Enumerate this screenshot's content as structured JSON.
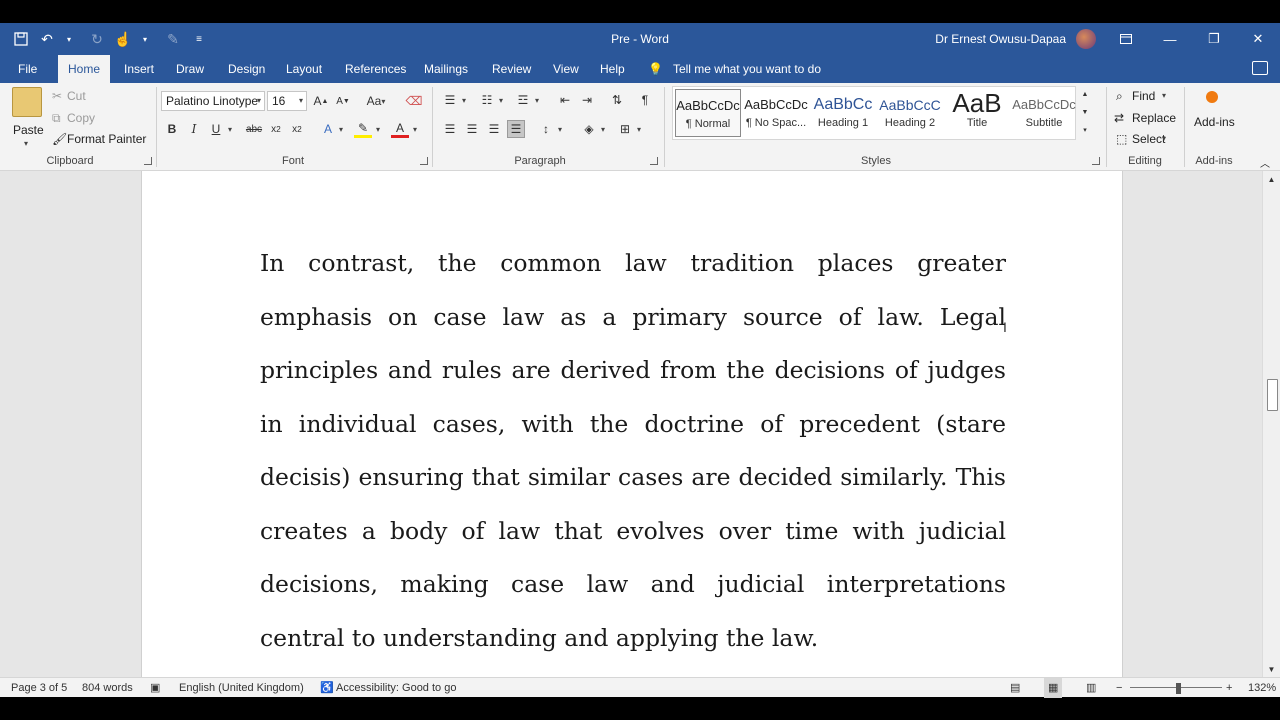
{
  "titlebar": {
    "doc_title": "Pre  -  Word",
    "user_name": "Dr Ernest Owusu-Dapaa",
    "qat_icons": [
      "save-icon",
      "undo-icon",
      "redo-icon",
      "touch-mode-icon",
      "pen-icon",
      "customize-icon"
    ]
  },
  "tabs": {
    "items": [
      "File",
      "Home",
      "Insert",
      "Draw",
      "Design",
      "Layout",
      "References",
      "Mailings",
      "Review",
      "View",
      "Help"
    ],
    "active": "Home",
    "tell_me": "Tell me what you want to do"
  },
  "ribbon": {
    "clipboard": {
      "paste": "Paste",
      "cut": "Cut",
      "copy": "Copy",
      "format_painter": "Format Painter",
      "label": "Clipboard"
    },
    "font": {
      "family": "Palatino Linotype",
      "size": "16",
      "change_case": "Aa",
      "label": "Font"
    },
    "paragraph": {
      "label": "Paragraph"
    },
    "styles": {
      "label": "Styles",
      "items": [
        {
          "sample": "AaBbCcDc",
          "name": "¶ Normal"
        },
        {
          "sample": "AaBbCcDc",
          "name": "¶ No Spac..."
        },
        {
          "sample": "AaBbCc",
          "name": "Heading 1"
        },
        {
          "sample": "AaBbCcC",
          "name": "Heading 2"
        },
        {
          "sample": "AaB",
          "name": "Title"
        },
        {
          "sample": "AaBbCcDc",
          "name": "Subtitle"
        }
      ],
      "selected": "¶ Normal"
    },
    "editing": {
      "find": "Find",
      "replace": "Replace",
      "select": "Select",
      "label": "Editing"
    },
    "addins": {
      "button": "Add-ins",
      "label": "Add-ins"
    }
  },
  "document": {
    "paragraph": "In contrast, the common law tradition places greater emphasis on case law as a primary source of law. Legal principles and rules are derived from the decisions of judges in individual cases, with the doctrine of precedent (stare decisis) ensuring that similar cases are decided similarly. This creates a body of law that evolves over time with judicial decisions, making case law and judicial interpretations central to understanding and applying the law."
  },
  "statusbar": {
    "page": "Page 3 of 5",
    "words": "804 words",
    "language": "English (United Kingdom)",
    "accessibility": "Accessibility: Good to go",
    "zoom": "132%"
  },
  "colors": {
    "accent": "#2b579a",
    "ribbon_bg": "#f3f3f3",
    "canvas_bg": "#e6e6e6"
  }
}
